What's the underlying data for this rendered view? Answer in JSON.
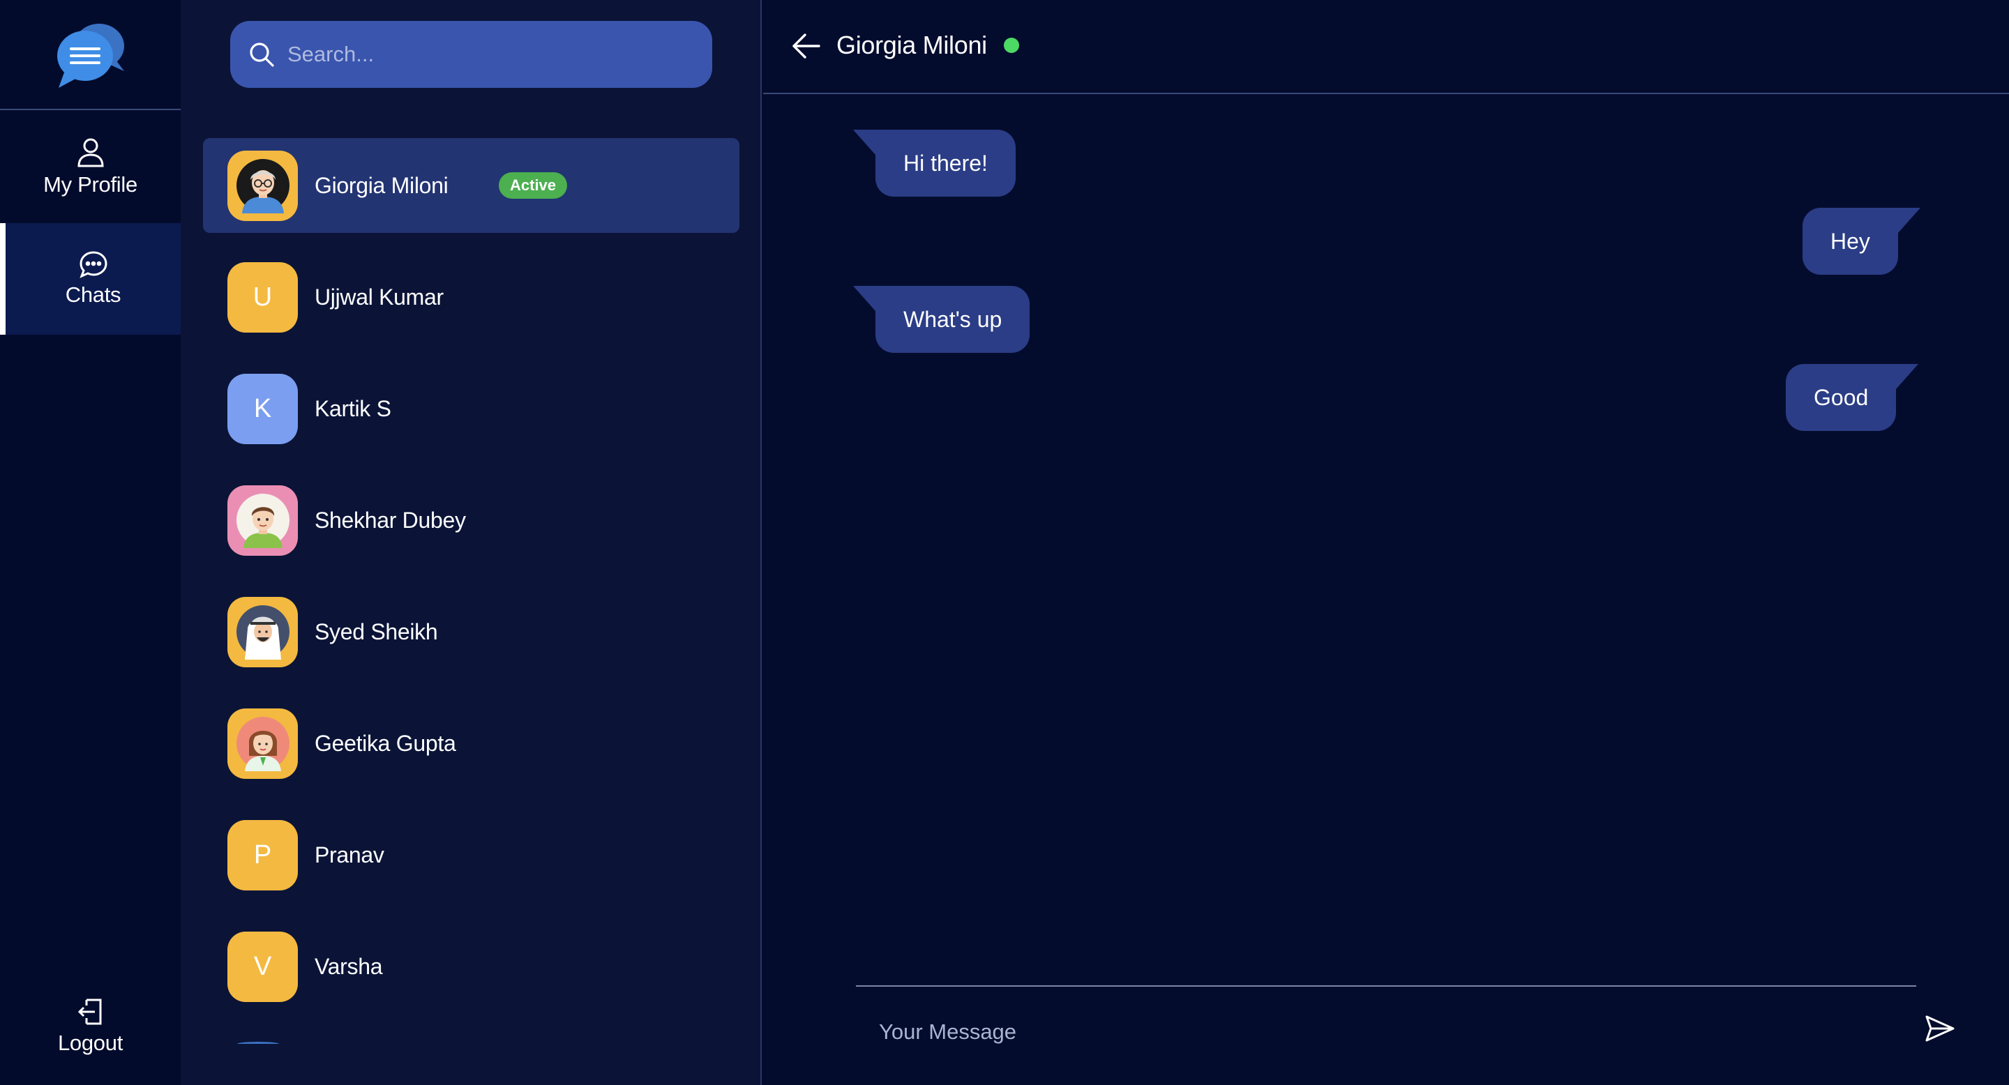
{
  "nav": {
    "logo_icon": "chat-bubbles-menu-icon",
    "items": [
      {
        "label": "My Profile",
        "icon": "user-icon"
      },
      {
        "label": "Chats",
        "icon": "chat-bubble-icon"
      }
    ],
    "logout": {
      "label": "Logout",
      "icon": "logout-icon"
    }
  },
  "search": {
    "placeholder": "Search..."
  },
  "contacts": [
    {
      "name": "Giorgia Miloni",
      "badge": "Active",
      "avatar": "illustrated",
      "avatar_bg": "#f4b940",
      "active": true
    },
    {
      "name": "Ujjwal Kumar",
      "initial": "U",
      "avatar_bg": "#f4b940"
    },
    {
      "name": "Kartik S",
      "initial": "K",
      "avatar_bg": "#7b9ef0"
    },
    {
      "name": "Shekhar Dubey",
      "avatar": "illustrated",
      "avatar_bg": "#ea8fb3"
    },
    {
      "name": "Syed Sheikh",
      "avatar": "illustrated",
      "avatar_bg": "#f4b940"
    },
    {
      "name": "Geetika Gupta",
      "avatar": "illustrated",
      "avatar_bg": "#f4b940"
    },
    {
      "name": "Pranav",
      "initial": "P",
      "avatar_bg": "#f4b940"
    },
    {
      "name": "Varsha",
      "initial": "V",
      "avatar_bg": "#f4b940"
    }
  ],
  "conversation": {
    "title": "Giorgia Miloni",
    "status_color": "#4cd964",
    "messages": [
      {
        "text": "Hi there!",
        "side": "left"
      },
      {
        "text": "Hey",
        "side": "right"
      },
      {
        "text": "What's up",
        "side": "left"
      },
      {
        "text": "Good",
        "side": "right"
      }
    ],
    "composer_placeholder": "Your Message"
  },
  "colors": {
    "background": "#040c2e",
    "panel": "#0b1437",
    "accent": "#3a55ae",
    "bubble": "#2b3d86",
    "active_badge": "#4caf50"
  }
}
